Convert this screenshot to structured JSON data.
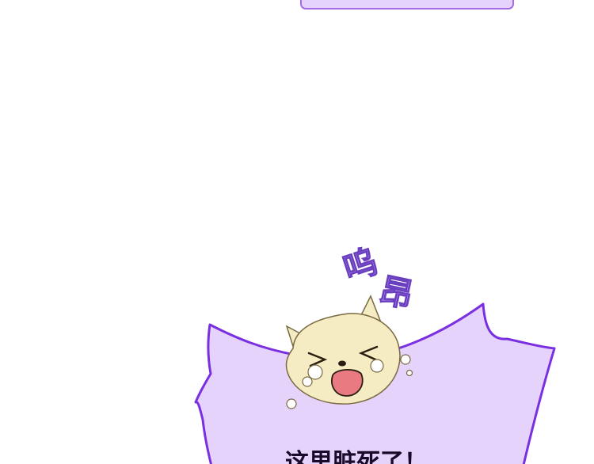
{
  "scene": {
    "sfx_text_1": "呜",
    "sfx_text_2": "昂",
    "caption": "这里脏死了！"
  },
  "colors": {
    "bubble_fill": "#e6d3fb",
    "bubble_stroke": "#7a2fe0",
    "sfx_fill": "#b78cf0",
    "dog_fur": "#f6ecc4",
    "dog_mouth": "#e97a82"
  },
  "icons": {
    "character": "crying-dog-head-icon"
  }
}
